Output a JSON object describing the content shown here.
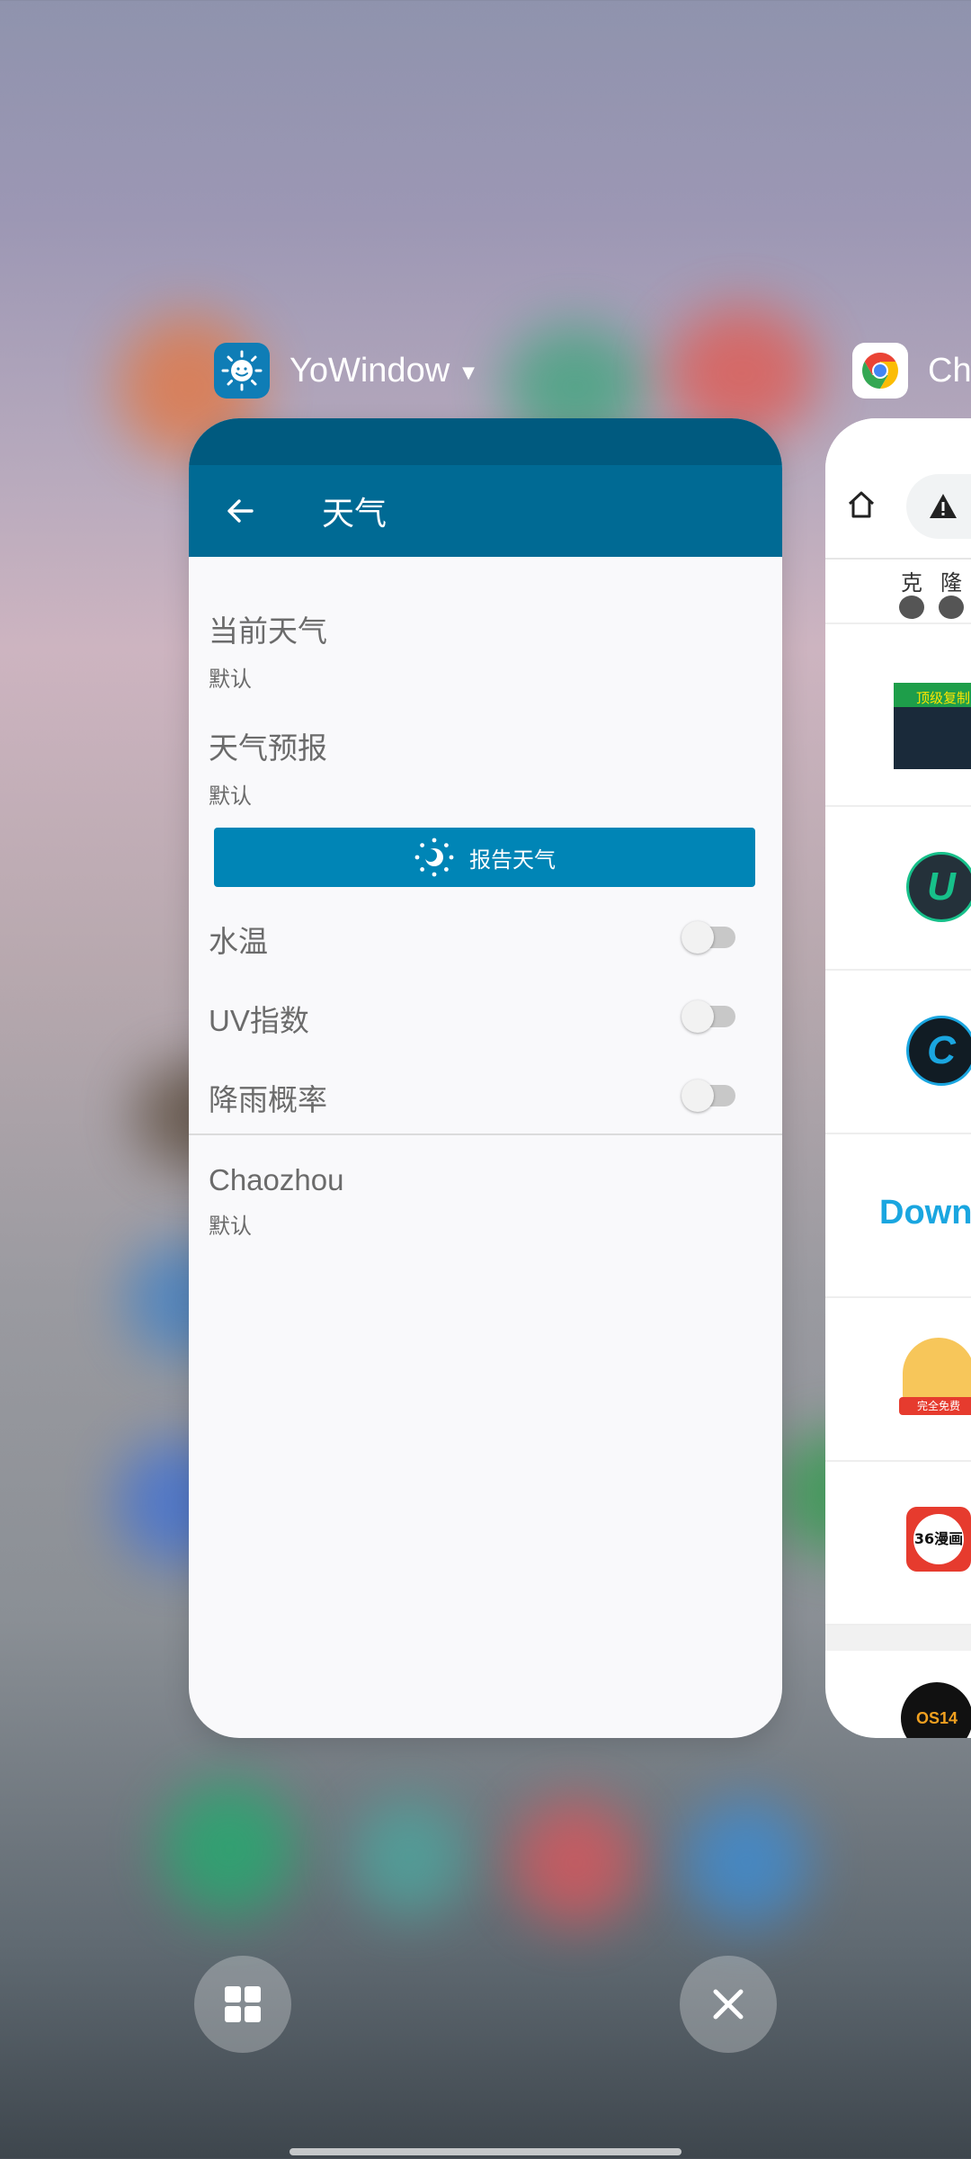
{
  "recents": {
    "primary_app": {
      "name": "YoWindow",
      "icon": "yowindow-sun-icon",
      "screen": {
        "title": "天气",
        "items": [
          {
            "title": "当前天气",
            "subtitle": "默认"
          },
          {
            "title": "天气预报",
            "subtitle": "默认"
          }
        ],
        "report_button": "报告天气",
        "toggles": [
          {
            "label": "水温",
            "on": false
          },
          {
            "label": "UV指数",
            "on": false
          },
          {
            "label": "降雨概率",
            "on": false
          }
        ],
        "location": {
          "title": "Chaozhou",
          "subtitle": "默认"
        }
      }
    },
    "secondary_app": {
      "name": "Ch",
      "icon": "chrome-icon",
      "tab_chars": [
        "克",
        "隆"
      ],
      "list_icons": [
        "顶级复制",
        "U",
        "C",
        "DownK",
        "完全免费",
        "36漫画",
        "OS14"
      ]
    }
  },
  "controls": {
    "split_icon": "grid-icon",
    "clear_icon": "close-icon"
  },
  "colors": {
    "toolbar": "#006a94",
    "status_strip": "#005a7f",
    "report_button": "#0085b6"
  }
}
